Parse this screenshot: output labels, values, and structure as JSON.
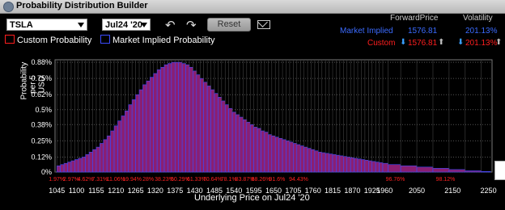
{
  "window": {
    "title": "Probability Distribution Builder"
  },
  "toolbar": {
    "symbol": "TSLA",
    "expiry": "Jul24 '20",
    "reset_label": "Reset"
  },
  "legend": {
    "custom": "Custom Probability",
    "market": "Market Implied Probability"
  },
  "stats": {
    "forward_header": "ForwardPrice",
    "vol_header": "Volatility",
    "market_label": "Market Implied",
    "market_forward": "1576.81",
    "market_vol": "201.13%",
    "custom_label": "Custom",
    "custom_forward": "1576.81",
    "custom_vol": "201.13%"
  },
  "colors": {
    "market": "#3b4bff",
    "custom": "#ff1e1e",
    "bar_fill": "#8a1f73"
  },
  "chart_data": {
    "type": "bar",
    "ylabel": "Probability per 5 USD",
    "xlabel": "Underlying Price on Jul24 '20",
    "yticks": [
      "0%",
      "0.12%",
      "0.25%",
      "0.38%",
      "0.5%",
      "0.62%",
      "0.75%",
      "0.88%"
    ],
    "ylim": [
      0,
      0.9
    ],
    "xticks": [
      "1045",
      "1100",
      "1155",
      "1210",
      "1265",
      "1320",
      "1375",
      "1430",
      "1485",
      "1540",
      "1595",
      "1650",
      "1705",
      "1760",
      "1815",
      "1870",
      "1925",
      "1960",
      "2050",
      "2150",
      "2250"
    ],
    "cumulative_labels": [
      "1.97%",
      "2.97%",
      "4.62%",
      "7.31%",
      "11.06%",
      "19.94%",
      "28%",
      "38.23%",
      "50.29%",
      "61.33%",
      "70.64%",
      "78.1%",
      "83.87%",
      "88.26%",
      "91.6%",
      "94.43%",
      "96.76%",
      "98.12%"
    ],
    "x": [
      1045,
      1055,
      1065,
      1075,
      1085,
      1095,
      1105,
      1115,
      1125,
      1135,
      1145,
      1155,
      1165,
      1175,
      1185,
      1195,
      1205,
      1215,
      1225,
      1235,
      1245,
      1255,
      1265,
      1275,
      1285,
      1295,
      1305,
      1315,
      1325,
      1335,
      1345,
      1355,
      1365,
      1375,
      1385,
      1395,
      1405,
      1415,
      1425,
      1435,
      1445,
      1455,
      1465,
      1475,
      1485,
      1495,
      1505,
      1515,
      1525,
      1535,
      1545,
      1555,
      1565,
      1575,
      1585,
      1595,
      1605,
      1615,
      1625,
      1635,
      1645,
      1655,
      1665,
      1675,
      1685,
      1695,
      1705,
      1715,
      1725,
      1735,
      1745,
      1755,
      1765,
      1775,
      1785,
      1795,
      1805,
      1815,
      1825,
      1835,
      1845,
      1855,
      1865,
      1875,
      1885,
      1895,
      1905,
      1915,
      1925,
      1935,
      1945,
      1955,
      1970,
      2005,
      2050,
      2095,
      2140,
      2185,
      2230
    ],
    "values": [
      0.05,
      0.06,
      0.07,
      0.08,
      0.09,
      0.1,
      0.11,
      0.12,
      0.14,
      0.16,
      0.18,
      0.2,
      0.23,
      0.26,
      0.29,
      0.33,
      0.37,
      0.41,
      0.45,
      0.49,
      0.54,
      0.58,
      0.62,
      0.66,
      0.7,
      0.73,
      0.76,
      0.79,
      0.82,
      0.84,
      0.86,
      0.87,
      0.88,
      0.88,
      0.88,
      0.87,
      0.86,
      0.84,
      0.81,
      0.78,
      0.75,
      0.72,
      0.69,
      0.66,
      0.63,
      0.6,
      0.57,
      0.54,
      0.51,
      0.48,
      0.46,
      0.44,
      0.42,
      0.4,
      0.38,
      0.36,
      0.35,
      0.33,
      0.32,
      0.3,
      0.29,
      0.28,
      0.27,
      0.26,
      0.25,
      0.24,
      0.23,
      0.22,
      0.21,
      0.2,
      0.19,
      0.18,
      0.17,
      0.16,
      0.155,
      0.15,
      0.145,
      0.14,
      0.135,
      0.13,
      0.125,
      0.12,
      0.115,
      0.11,
      0.105,
      0.1,
      0.095,
      0.09,
      0.085,
      0.08,
      0.075,
      0.07,
      0.06,
      0.05,
      0.04,
      0.03,
      0.02,
      0.01,
      0.005
    ],
    "grid": true
  }
}
